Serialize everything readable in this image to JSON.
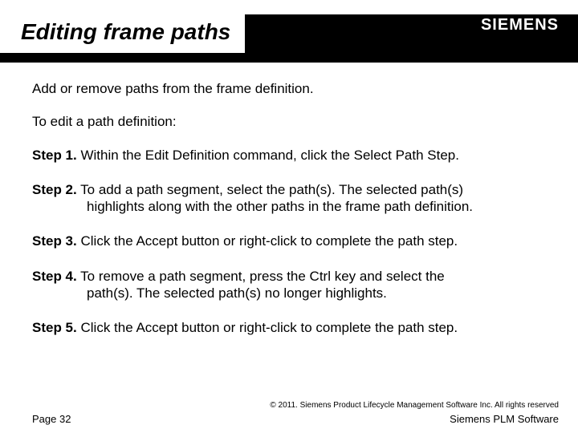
{
  "brand": {
    "logo_text": "SIEMENS"
  },
  "title": "Editing frame paths",
  "intro1": "Add or remove paths from the frame definition.",
  "intro2": "To edit a path definition:",
  "steps": {
    "s1": {
      "label": "Step 1.",
      "text": "Within the Edit Definition command, click the Select Path Step."
    },
    "s2": {
      "label": "Step 2.",
      "text_a": "To add a path segment, select the path(s). The selected path(s)",
      "text_b": "highlights along with the other paths in the frame path definition."
    },
    "s3": {
      "label": "Step 3.",
      "text": "Click the Accept button or right-click to complete the path step."
    },
    "s4": {
      "label": "Step 4.",
      "text_a": "To remove a path segment, press the Ctrl key and select the",
      "text_b": "path(s). The selected path(s) no longer highlights."
    },
    "s5": {
      "label": "Step 5.",
      "text": "Click the Accept button or right-click to complete the path step."
    }
  },
  "footer": {
    "copyright": "© 2011. Siemens Product Lifecycle Management Software Inc. All rights reserved",
    "page": "Page 32",
    "product": "Siemens PLM Software"
  }
}
